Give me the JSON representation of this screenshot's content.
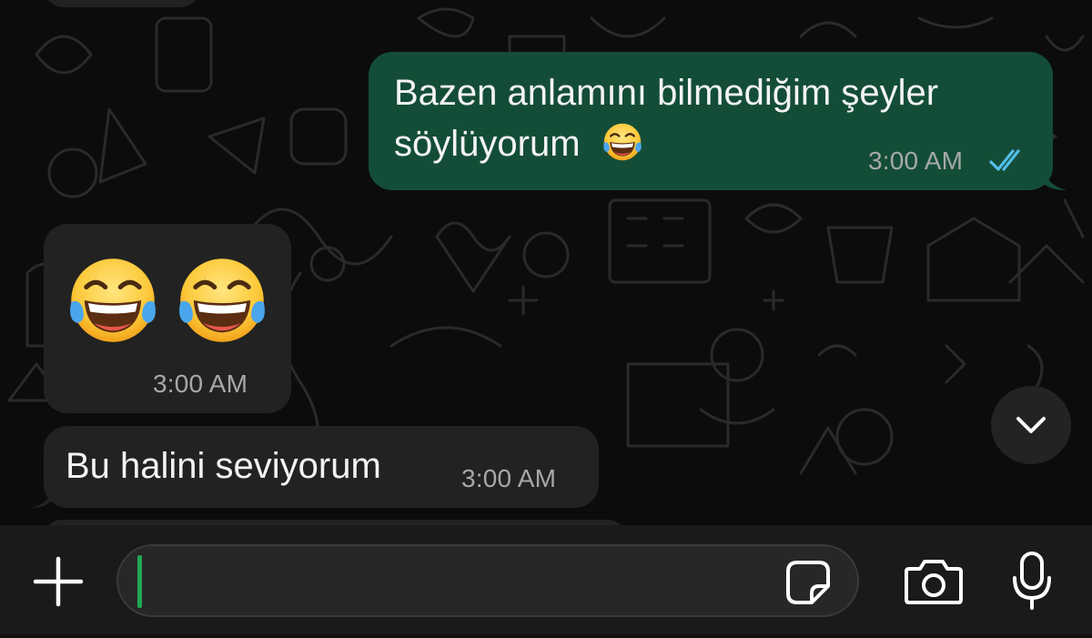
{
  "chat": {
    "messages": [
      {
        "direction": "outgoing",
        "lines": [
          "Bazen anlamını bilmediğim şeyler",
          "söylüyorum"
        ],
        "emoji": "face-with-tears-of-joy",
        "time": "3:00 AM",
        "status": "read"
      },
      {
        "direction": "incoming",
        "emoji_count": 2,
        "emoji": "face-with-tears-of-joy",
        "time": "3:00 AM"
      },
      {
        "direction": "incoming",
        "text": "Bu halini seviyorum",
        "time": "3:00 AM"
      }
    ]
  },
  "composer": {
    "value": "",
    "icons": {
      "attach": "plus-icon",
      "sticker": "sticker-icon",
      "camera": "camera-icon",
      "voice": "microphone-icon"
    }
  },
  "colors": {
    "outgoing_bubble": "#144d37",
    "incoming_bubble": "#222222",
    "read_ticks": "#53bdeb",
    "caret": "#1fa855"
  }
}
